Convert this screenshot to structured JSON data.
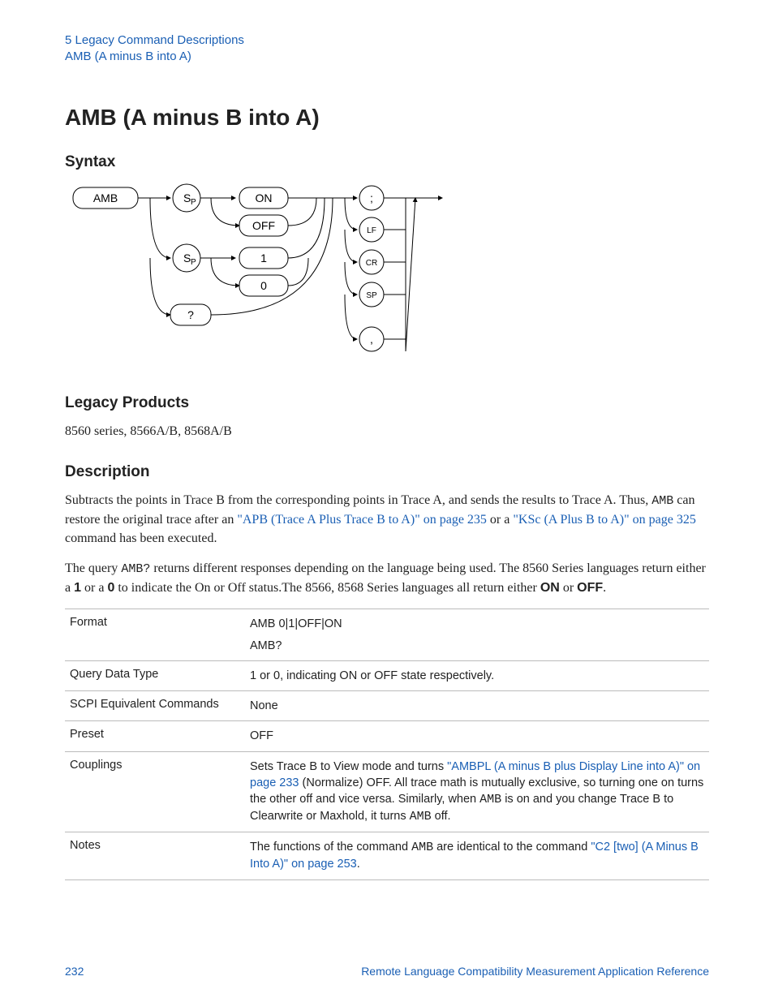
{
  "header": {
    "line1": "5  Legacy Command Descriptions",
    "line2": "AMB (A minus B into A)"
  },
  "title": "AMB (A minus B into A)",
  "sections": {
    "syntax": "Syntax",
    "legacy_products": "Legacy Products",
    "description": "Description"
  },
  "legacy_products_text": "8560 series, 8566A/B, 8568A/B",
  "description": {
    "p1_pre": "Subtracts the points in Trace B from the corresponding points in Trace A, and sends the results to Trace A. Thus, ",
    "amb_mono": "AMB",
    "p1_mid": " can restore the original trace after an ",
    "link1_a": "\"APB (Trace A Plus Trace B to A)\" on ",
    "link1_b": "page 235",
    "p1_join": " or a ",
    "link2": "\"KSc (A Plus B to A)\" on page 325",
    "p1_tail": " command has been executed.",
    "p2_pre": "The query ",
    "ambq_mono": "AMB?",
    "p2_mid1": " returns different responses depending on the language being used. The 8560 Series languages return either a ",
    "b1": "1",
    "p2_or1": " or a ",
    "b0": "0",
    "p2_mid2": " to indicate the On or Off status.The 8566, 8568 Series languages all return either ",
    "on": "ON",
    "p2_or2": " or ",
    "off": "OFF",
    "p2_tail": "."
  },
  "diagram": {
    "amb": "AMB",
    "sp": "S",
    "sp_sub": "P",
    "on": "ON",
    "off": "OFF",
    "one": "1",
    "zero": "0",
    "q": "?",
    "semi": ";",
    "lf": "LF",
    "cr": "CR",
    "ssp": "SP",
    "comma": ","
  },
  "table": {
    "rows": [
      {
        "label": "Format",
        "value1": "AMB 0|1|OFF|ON",
        "value2": "AMB?"
      },
      {
        "label": "Query Data Type",
        "value": "1 or 0, indicating ON or OFF state respectively."
      },
      {
        "label": "SCPI Equivalent Commands",
        "value": "None"
      },
      {
        "label": "Preset",
        "value": "OFF"
      },
      {
        "label": "Couplings",
        "pre": "Sets Trace B to View mode and turns ",
        "link1_a": "\"AMBPL (A minus B plus Display Line into A)\" on ",
        "link1_b": "page 233",
        "mid1": " (Normalize) OFF. All trace math is mutually exclusive, so turning one on turns the other off and vice versa. Similarly, when ",
        "m1": "AMB",
        "mid2": " is on and you change Trace B to Clearwrite or Maxhold, it turns ",
        "m2": "AMB",
        "tail": " off."
      },
      {
        "label": "Notes",
        "pre": "The functions of the command ",
        "m1": "AMB",
        "mid1": " are identical to the command ",
        "link1_a": "\"C2 [two] (A Minus B ",
        "link1_b": "Into A)\" on page 253",
        "tail": "."
      }
    ]
  },
  "footer": {
    "page": "232",
    "book": "Remote Language Compatibility Measurement Application Reference"
  }
}
